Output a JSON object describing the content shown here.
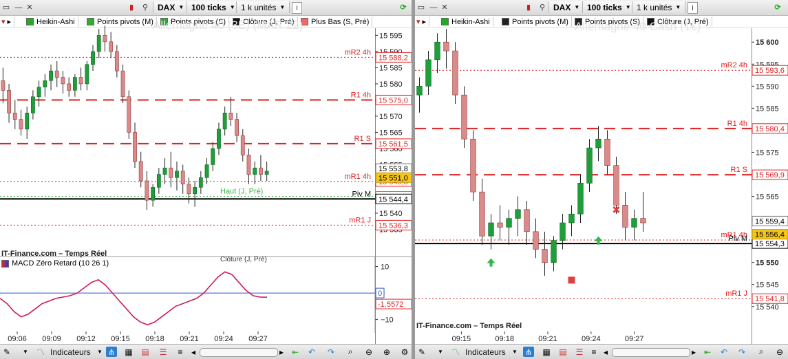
{
  "toolbar": {
    "symbol": "DAX",
    "ticks": "100 ticks",
    "units": "1 k unités",
    "info_icon": "info-icon"
  },
  "left": {
    "legend": [
      "Heikin-Ashi",
      "Points pivots (M)",
      "Points pivots (S)",
      "Clôture (J, Pré)",
      "Plus Bas (S, Pré)"
    ],
    "watermark": "Allemagne 40 (3E) (MAR 22)",
    "source": "IT-Finance.com – Temps Réel",
    "macd_title": "MACD Zéro Retard (10 26 1)",
    "hidden_label": "Clôture (J, Pré)",
    "colors": {
      "bull": "#1f9e3a",
      "bear": "#d98a8a"
    }
  },
  "right": {
    "legend": [
      "Heikin-Ashi",
      "Points pivots (M)",
      "Points pivots (S)",
      "Clôture (J, Pré)"
    ],
    "watermark": "Allemagne 40 Cash (1€)",
    "source": "IT-Finance.com – Temps Réel"
  },
  "bottom": {
    "indicators_label": "Indicateurs"
  },
  "chart_data": [
    {
      "type": "candlestick",
      "id": "left_price",
      "ylim": [
        15530,
        15597
      ],
      "y_ticks": [
        15535,
        15540,
        15545,
        15550,
        15555,
        15560,
        15565,
        15570,
        15575,
        15580,
        15585,
        15590,
        15595
      ],
      "x_ticks": [
        "09:06",
        "09:09",
        "09:12",
        "09:15",
        "09:18",
        "09:21",
        "09:24",
        "09:27"
      ],
      "levels": [
        {
          "name": "mR2 4h",
          "value": 15588.2,
          "label": "15 588,2",
          "style": "dot-red"
        },
        {
          "name": "R1 4h",
          "value": 15575.0,
          "label": "15 575,0",
          "style": "dash-red"
        },
        {
          "name": "R1 S",
          "value": 15561.5,
          "label": "15 561,5",
          "style": "dash-red"
        },
        {
          "name": "mR1 4h",
          "value": 15549.8,
          "label": "15 549,8",
          "style": "dot-red"
        },
        {
          "name": "Haut (J, Pré)",
          "value": 15545.2,
          "label": "15 545,2",
          "style": "dot-green"
        },
        {
          "name": "Piv M",
          "value": 15544.4,
          "label": "15 544,4",
          "style": "solid-black"
        },
        {
          "name": "mR1 J",
          "value": 15536.3,
          "label": "15 536,3",
          "style": "dot-red"
        }
      ],
      "price_tags": [
        {
          "value": 15553.8,
          "label": "15 553,8",
          "kind": "plain"
        },
        {
          "value": 15551.0,
          "label": "15 551,0",
          "kind": "current"
        }
      ],
      "candles": [
        [
          15581,
          15585,
          15574,
          15578
        ],
        [
          15578,
          15580,
          15568,
          15571
        ],
        [
          15571,
          15575,
          15566,
          15569
        ],
        [
          15569,
          15572,
          15564,
          15566
        ],
        [
          15566,
          15573,
          15563,
          15571
        ],
        [
          15571,
          15578,
          15569,
          15576
        ],
        [
          15576,
          15581,
          15573,
          15579
        ],
        [
          15579,
          15583,
          15576,
          15581
        ],
        [
          15581,
          15586,
          15578,
          15584
        ],
        [
          15584,
          15587,
          15579,
          15582
        ],
        [
          15582,
          15584,
          15577,
          15580
        ],
        [
          15580,
          15582,
          15576,
          15578
        ],
        [
          15578,
          15583,
          15576,
          15582
        ],
        [
          15582,
          15585,
          15578,
          15580
        ],
        [
          15580,
          15587,
          15578,
          15586
        ],
        [
          15586,
          15592,
          15584,
          15590
        ],
        [
          15590,
          15597,
          15588,
          15595
        ],
        [
          15595,
          15598,
          15590,
          15593
        ],
        [
          15593,
          15596,
          15588,
          15590
        ],
        [
          15590,
          15592,
          15582,
          15584
        ],
        [
          15584,
          15586,
          15574,
          15576
        ],
        [
          15576,
          15578,
          15563,
          15565
        ],
        [
          15565,
          15568,
          15554,
          15556
        ],
        [
          15556,
          15559,
          15548,
          15550
        ],
        [
          15550,
          15553,
          15541,
          15544
        ],
        [
          15544,
          15549,
          15542,
          15548
        ],
        [
          15548,
          15554,
          15546,
          15552
        ],
        [
          15552,
          15557,
          15549,
          15554
        ],
        [
          15554,
          15559,
          15548,
          15551
        ],
        [
          15551,
          15556,
          15547,
          15553
        ],
        [
          15553,
          15555,
          15546,
          15549
        ],
        [
          15549,
          15551,
          15543,
          15546
        ],
        [
          15546,
          15550,
          15542,
          15548
        ],
        [
          15548,
          15553,
          15546,
          15551
        ],
        [
          15551,
          15557,
          15549,
          15555
        ],
        [
          15555,
          15562,
          15553,
          15560
        ],
        [
          15560,
          15568,
          15558,
          15566
        ],
        [
          15566,
          15573,
          15564,
          15571
        ],
        [
          15571,
          15576,
          15567,
          15569
        ],
        [
          15569,
          15571,
          15562,
          15564
        ],
        [
          15564,
          15566,
          15556,
          15558
        ],
        [
          15558,
          15560,
          15549,
          15552
        ],
        [
          15552,
          15556,
          15549,
          15554
        ],
        [
          15554,
          15558,
          15550,
          15552
        ],
        [
          15552,
          15556,
          15550,
          15553
        ]
      ]
    },
    {
      "type": "line",
      "id": "left_macd",
      "title": "MACD Zéro Retard (10 26 1)",
      "ylim": [
        -14,
        13
      ],
      "y_ticks": [
        -10,
        0,
        10
      ],
      "markers": [
        {
          "label": "0",
          "value": 0
        },
        {
          "label": "-1,5572",
          "value": -1.5572
        }
      ],
      "values": [
        -2,
        -4,
        -7,
        -9,
        -8,
        -6,
        -4,
        -3,
        -2,
        -1.5,
        -1,
        0,
        2,
        4,
        5,
        3,
        0,
        -3,
        -6,
        -9,
        -11,
        -12,
        -11,
        -9,
        -7,
        -5,
        -4,
        -3,
        -2,
        0,
        3,
        6,
        8,
        7,
        4,
        1,
        -1,
        -1.5,
        -1.6
      ]
    },
    {
      "type": "candlestick",
      "id": "right_price",
      "ylim": [
        15537,
        15603
      ],
      "y_ticks": [
        15540,
        15545,
        15550,
        15555,
        15560,
        15565,
        15570,
        15575,
        15580,
        15585,
        15590,
        15595,
        15600
      ],
      "bold_ticks": [
        15550,
        15600
      ],
      "x_ticks": [
        "09:15",
        "09:18",
        "09:21",
        "09:24",
        "09:27"
      ],
      "levels": [
        {
          "name": "mR2 4h",
          "value": 15593.6,
          "label": "15 593,6",
          "style": "dot-red"
        },
        {
          "name": "R1 4h",
          "value": 15580.4,
          "label": "15 580,4",
          "style": "dash-red"
        },
        {
          "name": "R1 S",
          "value": 15569.9,
          "label": "15 569,9",
          "style": "dash-red"
        },
        {
          "name": "mR1 4h",
          "value": 15555.1,
          "label": "15 555,1",
          "style": "dot-red"
        },
        {
          "name": "Piv M",
          "value": 15554.3,
          "label": "15 554,3",
          "style": "solid-black"
        },
        {
          "name": "mR1 J",
          "value": 15541.8,
          "label": "15 541,8",
          "style": "dot-red"
        }
      ],
      "price_tags": [
        {
          "value": 15559.4,
          "label": "15 559,4",
          "kind": "plain"
        },
        {
          "value": 15556.4,
          "label": "15 556,4",
          "kind": "current"
        }
      ],
      "signals": [
        {
          "type": "up-arrow",
          "index": 8,
          "value": 15550
        },
        {
          "type": "square",
          "index": 17,
          "value": 15546
        },
        {
          "type": "up-arrow",
          "index": 20,
          "value": 15555
        },
        {
          "type": "cross",
          "index": 22,
          "value": 15562
        }
      ],
      "candles": [
        [
          15588,
          15592,
          15584,
          15590
        ],
        [
          15590,
          15598,
          15588,
          15596
        ],
        [
          15596,
          15602,
          15593,
          15600
        ],
        [
          15600,
          15603,
          15594,
          15598
        ],
        [
          15598,
          15600,
          15586,
          15588
        ],
        [
          15588,
          15590,
          15576,
          15578
        ],
        [
          15578,
          15580,
          15564,
          15566
        ],
        [
          15566,
          15569,
          15554,
          15556
        ],
        [
          15556,
          15561,
          15553,
          15559
        ],
        [
          15559,
          15563,
          15555,
          15558
        ],
        [
          15558,
          15562,
          15554,
          15560
        ],
        [
          15560,
          15565,
          15556,
          15562
        ],
        [
          15562,
          15564,
          15554,
          15557
        ],
        [
          15557,
          15560,
          15551,
          15553
        ],
        [
          15553,
          15557,
          15547,
          15550
        ],
        [
          15550,
          15556,
          15548,
          15555
        ],
        [
          15555,
          15561,
          15553,
          15559
        ],
        [
          15559,
          15563,
          15556,
          15561
        ],
        [
          15561,
          15570,
          15559,
          15568
        ],
        [
          15568,
          15578,
          15566,
          15576
        ],
        [
          15576,
          15581,
          15573,
          15578
        ],
        [
          15578,
          15580,
          15570,
          15572
        ],
        [
          15572,
          15574,
          15561,
          15563
        ],
        [
          15563,
          15566,
          15555,
          15558
        ],
        [
          15558,
          15562,
          15555,
          15560
        ],
        [
          15560,
          15566,
          15557,
          15559
        ]
      ]
    }
  ]
}
